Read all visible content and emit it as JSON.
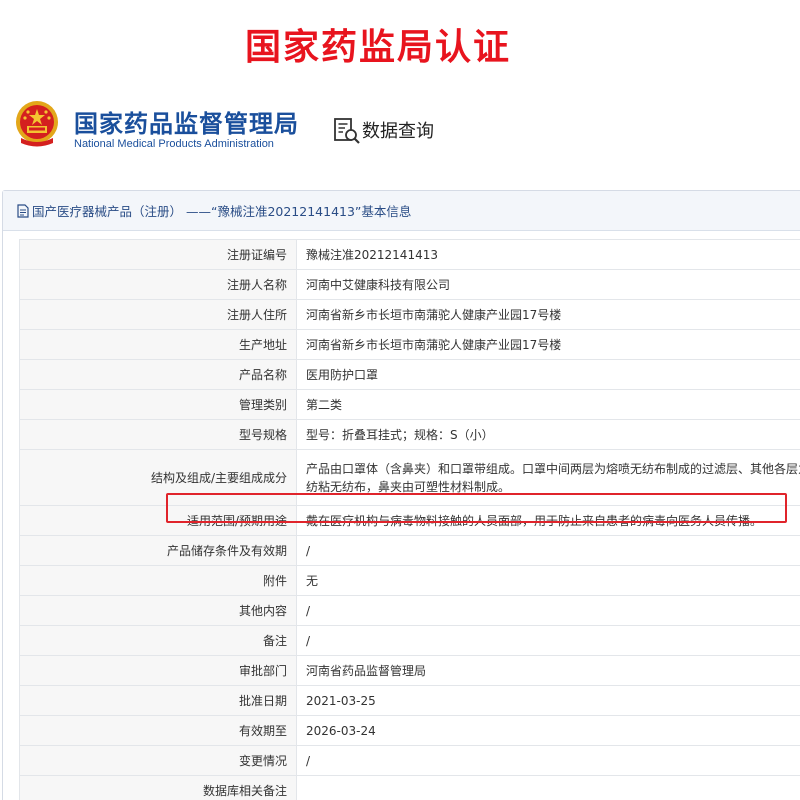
{
  "banner": {
    "title": "国家药监局认证"
  },
  "header": {
    "agency_name": "国家药品监督管理局",
    "agency_name_en": "National Medical Products Administration",
    "query_label": "数据查询",
    "emblem_icon": "national-emblem-icon",
    "query_icon": "document-search-icon"
  },
  "panel": {
    "title": "国产医疗器械产品（注册） ——“豫械注准20212141413”基本信息",
    "rows": [
      {
        "label": "注册证编号",
        "value": "豫械注准20212141413"
      },
      {
        "label": "注册人名称",
        "value": "河南中艾健康科技有限公司"
      },
      {
        "label": "注册人住所",
        "value": "河南省新乡市长垣市南蒲驼人健康产业园17号楼"
      },
      {
        "label": "生产地址",
        "value": "河南省新乡市长垣市南蒲驼人健康产业园17号楼"
      },
      {
        "label": "产品名称",
        "value": "医用防护口罩"
      },
      {
        "label": "管理类别",
        "value": "第二类"
      },
      {
        "label": "型号规格",
        "value": "型号：折叠耳挂式；规格：S（小）"
      },
      {
        "label": "结构及组成/主要组成成分",
        "value": "产品由口罩体（含鼻夹）和口罩带组成。口罩中间两层为熔喷无纺布制成的过滤层、其他各层为纺粘无纺布，鼻夹由可塑性材料制成。"
      },
      {
        "label": "适用范围/预期用途",
        "value": "戴在医疗机构与病毒物料接触的人员面部，用于防止来自患者的病毒向医务人员传播。"
      },
      {
        "label": "产品储存条件及有效期",
        "value": "/"
      },
      {
        "label": "附件",
        "value": "无"
      },
      {
        "label": "其他内容",
        "value": "/"
      },
      {
        "label": "备注",
        "value": "/"
      },
      {
        "label": "审批部门",
        "value": "河南省药品监督管理局"
      },
      {
        "label": "批准日期",
        "value": "2021-03-25"
      },
      {
        "label": "有效期至",
        "value": "2026-03-24"
      },
      {
        "label": "变更情况",
        "value": "/"
      },
      {
        "label": "数据库相关备注",
        "value": ""
      }
    ]
  },
  "colors": {
    "banner": "#e8141e",
    "agency": "#1a4f9c",
    "highlight_box": "#e0242b",
    "label_bg": "#f7f7f7"
  }
}
